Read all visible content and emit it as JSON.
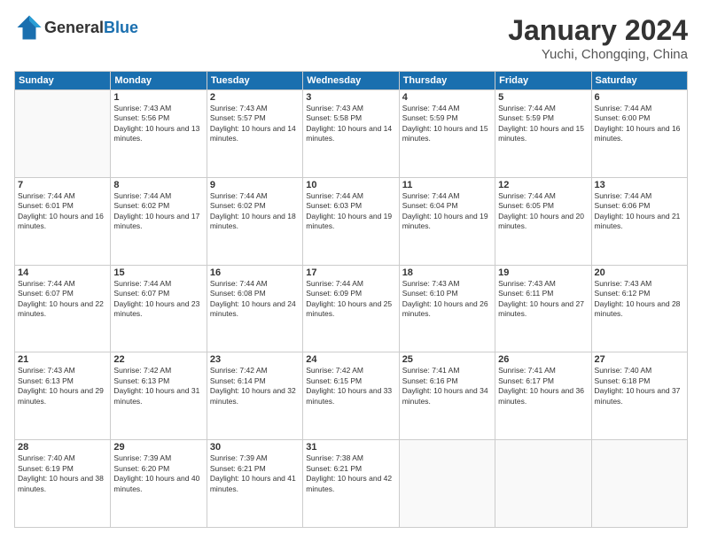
{
  "header": {
    "logo_general": "General",
    "logo_blue": "Blue",
    "month_title": "January 2024",
    "location": "Yuchi, Chongqing, China"
  },
  "weekdays": [
    "Sunday",
    "Monday",
    "Tuesday",
    "Wednesday",
    "Thursday",
    "Friday",
    "Saturday"
  ],
  "weeks": [
    [
      {
        "day": "",
        "sunrise": "",
        "sunset": "",
        "daylight": ""
      },
      {
        "day": "1",
        "sunrise": "Sunrise: 7:43 AM",
        "sunset": "Sunset: 5:56 PM",
        "daylight": "Daylight: 10 hours and 13 minutes."
      },
      {
        "day": "2",
        "sunrise": "Sunrise: 7:43 AM",
        "sunset": "Sunset: 5:57 PM",
        "daylight": "Daylight: 10 hours and 14 minutes."
      },
      {
        "day": "3",
        "sunrise": "Sunrise: 7:43 AM",
        "sunset": "Sunset: 5:58 PM",
        "daylight": "Daylight: 10 hours and 14 minutes."
      },
      {
        "day": "4",
        "sunrise": "Sunrise: 7:44 AM",
        "sunset": "Sunset: 5:59 PM",
        "daylight": "Daylight: 10 hours and 15 minutes."
      },
      {
        "day": "5",
        "sunrise": "Sunrise: 7:44 AM",
        "sunset": "Sunset: 5:59 PM",
        "daylight": "Daylight: 10 hours and 15 minutes."
      },
      {
        "day": "6",
        "sunrise": "Sunrise: 7:44 AM",
        "sunset": "Sunset: 6:00 PM",
        "daylight": "Daylight: 10 hours and 16 minutes."
      }
    ],
    [
      {
        "day": "7",
        "sunrise": "Sunrise: 7:44 AM",
        "sunset": "Sunset: 6:01 PM",
        "daylight": "Daylight: 10 hours and 16 minutes."
      },
      {
        "day": "8",
        "sunrise": "Sunrise: 7:44 AM",
        "sunset": "Sunset: 6:02 PM",
        "daylight": "Daylight: 10 hours and 17 minutes."
      },
      {
        "day": "9",
        "sunrise": "Sunrise: 7:44 AM",
        "sunset": "Sunset: 6:02 PM",
        "daylight": "Daylight: 10 hours and 18 minutes."
      },
      {
        "day": "10",
        "sunrise": "Sunrise: 7:44 AM",
        "sunset": "Sunset: 6:03 PM",
        "daylight": "Daylight: 10 hours and 19 minutes."
      },
      {
        "day": "11",
        "sunrise": "Sunrise: 7:44 AM",
        "sunset": "Sunset: 6:04 PM",
        "daylight": "Daylight: 10 hours and 19 minutes."
      },
      {
        "day": "12",
        "sunrise": "Sunrise: 7:44 AM",
        "sunset": "Sunset: 6:05 PM",
        "daylight": "Daylight: 10 hours and 20 minutes."
      },
      {
        "day": "13",
        "sunrise": "Sunrise: 7:44 AM",
        "sunset": "Sunset: 6:06 PM",
        "daylight": "Daylight: 10 hours and 21 minutes."
      }
    ],
    [
      {
        "day": "14",
        "sunrise": "Sunrise: 7:44 AM",
        "sunset": "Sunset: 6:07 PM",
        "daylight": "Daylight: 10 hours and 22 minutes."
      },
      {
        "day": "15",
        "sunrise": "Sunrise: 7:44 AM",
        "sunset": "Sunset: 6:07 PM",
        "daylight": "Daylight: 10 hours and 23 minutes."
      },
      {
        "day": "16",
        "sunrise": "Sunrise: 7:44 AM",
        "sunset": "Sunset: 6:08 PM",
        "daylight": "Daylight: 10 hours and 24 minutes."
      },
      {
        "day": "17",
        "sunrise": "Sunrise: 7:44 AM",
        "sunset": "Sunset: 6:09 PM",
        "daylight": "Daylight: 10 hours and 25 minutes."
      },
      {
        "day": "18",
        "sunrise": "Sunrise: 7:43 AM",
        "sunset": "Sunset: 6:10 PM",
        "daylight": "Daylight: 10 hours and 26 minutes."
      },
      {
        "day": "19",
        "sunrise": "Sunrise: 7:43 AM",
        "sunset": "Sunset: 6:11 PM",
        "daylight": "Daylight: 10 hours and 27 minutes."
      },
      {
        "day": "20",
        "sunrise": "Sunrise: 7:43 AM",
        "sunset": "Sunset: 6:12 PM",
        "daylight": "Daylight: 10 hours and 28 minutes."
      }
    ],
    [
      {
        "day": "21",
        "sunrise": "Sunrise: 7:43 AM",
        "sunset": "Sunset: 6:13 PM",
        "daylight": "Daylight: 10 hours and 29 minutes."
      },
      {
        "day": "22",
        "sunrise": "Sunrise: 7:42 AM",
        "sunset": "Sunset: 6:13 PM",
        "daylight": "Daylight: 10 hours and 31 minutes."
      },
      {
        "day": "23",
        "sunrise": "Sunrise: 7:42 AM",
        "sunset": "Sunset: 6:14 PM",
        "daylight": "Daylight: 10 hours and 32 minutes."
      },
      {
        "day": "24",
        "sunrise": "Sunrise: 7:42 AM",
        "sunset": "Sunset: 6:15 PM",
        "daylight": "Daylight: 10 hours and 33 minutes."
      },
      {
        "day": "25",
        "sunrise": "Sunrise: 7:41 AM",
        "sunset": "Sunset: 6:16 PM",
        "daylight": "Daylight: 10 hours and 34 minutes."
      },
      {
        "day": "26",
        "sunrise": "Sunrise: 7:41 AM",
        "sunset": "Sunset: 6:17 PM",
        "daylight": "Daylight: 10 hours and 36 minutes."
      },
      {
        "day": "27",
        "sunrise": "Sunrise: 7:40 AM",
        "sunset": "Sunset: 6:18 PM",
        "daylight": "Daylight: 10 hours and 37 minutes."
      }
    ],
    [
      {
        "day": "28",
        "sunrise": "Sunrise: 7:40 AM",
        "sunset": "Sunset: 6:19 PM",
        "daylight": "Daylight: 10 hours and 38 minutes."
      },
      {
        "day": "29",
        "sunrise": "Sunrise: 7:39 AM",
        "sunset": "Sunset: 6:20 PM",
        "daylight": "Daylight: 10 hours and 40 minutes."
      },
      {
        "day": "30",
        "sunrise": "Sunrise: 7:39 AM",
        "sunset": "Sunset: 6:21 PM",
        "daylight": "Daylight: 10 hours and 41 minutes."
      },
      {
        "day": "31",
        "sunrise": "Sunrise: 7:38 AM",
        "sunset": "Sunset: 6:21 PM",
        "daylight": "Daylight: 10 hours and 42 minutes."
      },
      {
        "day": "",
        "sunrise": "",
        "sunset": "",
        "daylight": ""
      },
      {
        "day": "",
        "sunrise": "",
        "sunset": "",
        "daylight": ""
      },
      {
        "day": "",
        "sunrise": "",
        "sunset": "",
        "daylight": ""
      }
    ]
  ]
}
